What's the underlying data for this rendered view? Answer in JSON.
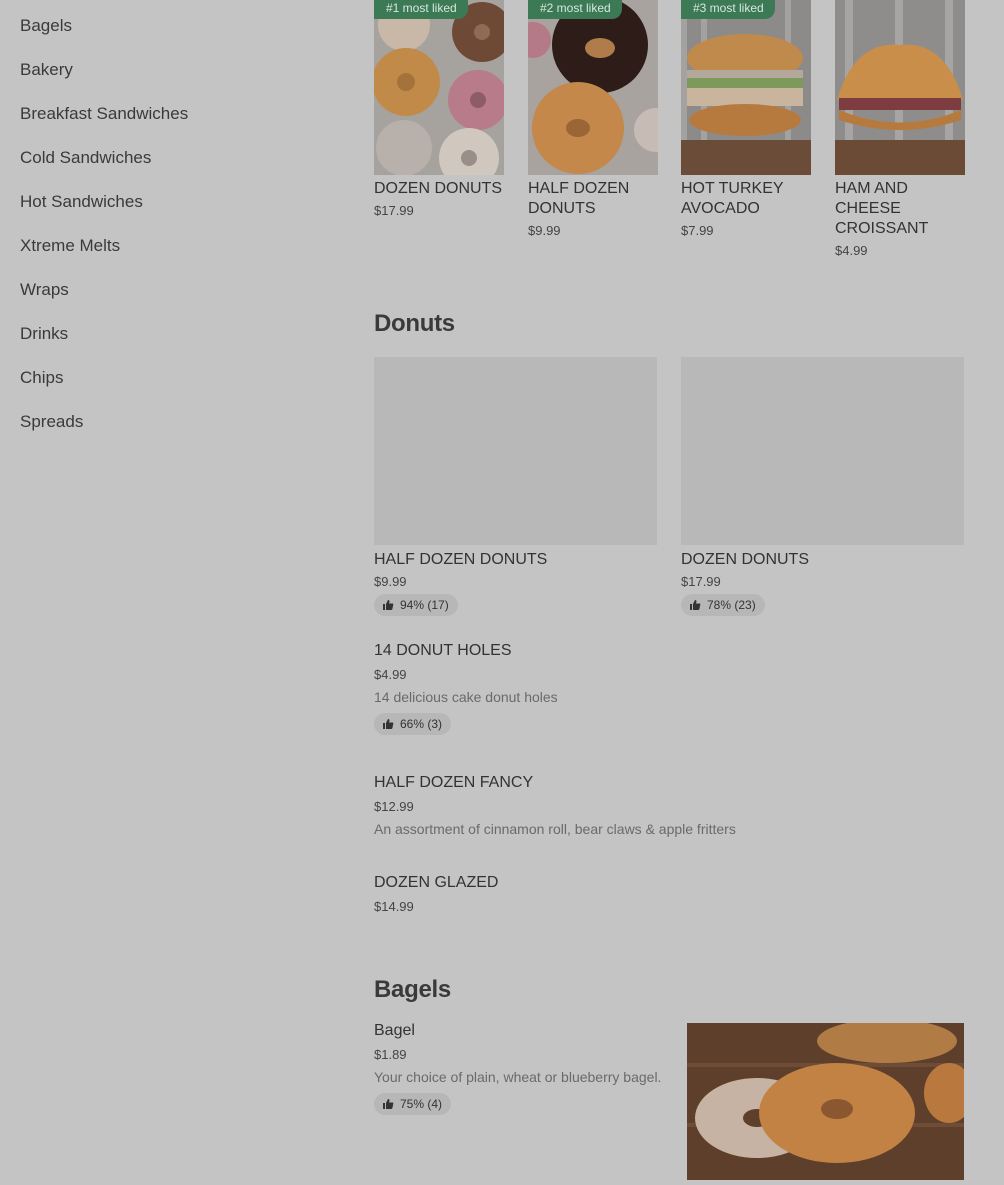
{
  "sidebar": {
    "items": [
      "Bagels",
      "Bakery",
      "Breakfast Sandwiches",
      "Cold Sandwiches",
      "Hot Sandwiches",
      "Xtreme Melts",
      "Wraps",
      "Drinks",
      "Chips",
      "Spreads"
    ]
  },
  "featured": [
    {
      "badge": "#1 most liked",
      "title": "DOZEN DONUTS",
      "price": "$17.99"
    },
    {
      "badge": "#2 most liked",
      "title": "HALF DOZEN DONUTS",
      "price": "$9.99"
    },
    {
      "badge": "#3 most liked",
      "title": "HOT TURKEY AVOCADO",
      "price": "$7.99"
    },
    {
      "badge": "",
      "title": "HAM AND CHEESE CROISSANT",
      "price": "$4.99"
    }
  ],
  "donuts": {
    "title": "Donuts",
    "cards": [
      {
        "title": "HALF DOZEN DONUTS",
        "price": "$9.99",
        "rating": "94% (17)"
      },
      {
        "title": "DOZEN DONUTS",
        "price": "$17.99",
        "rating": "78% (23)"
      }
    ],
    "list": [
      {
        "title": "14 DONUT HOLES",
        "price": "$4.99",
        "desc": "14 delicious cake donut holes",
        "rating": "66% (3)"
      },
      {
        "title": "HALF DOZEN FANCY",
        "price": "$12.99",
        "desc": "An assortment of cinnamon roll, bear claws & apple fritters"
      },
      {
        "title": "DOZEN GLAZED",
        "price": "$14.99"
      }
    ]
  },
  "bagels": {
    "title": "Bagels",
    "item": {
      "title": "Bagel",
      "price": "$1.89",
      "desc": "Your choice of plain, wheat or blueberry bagel.",
      "rating": "75% (4)"
    }
  }
}
